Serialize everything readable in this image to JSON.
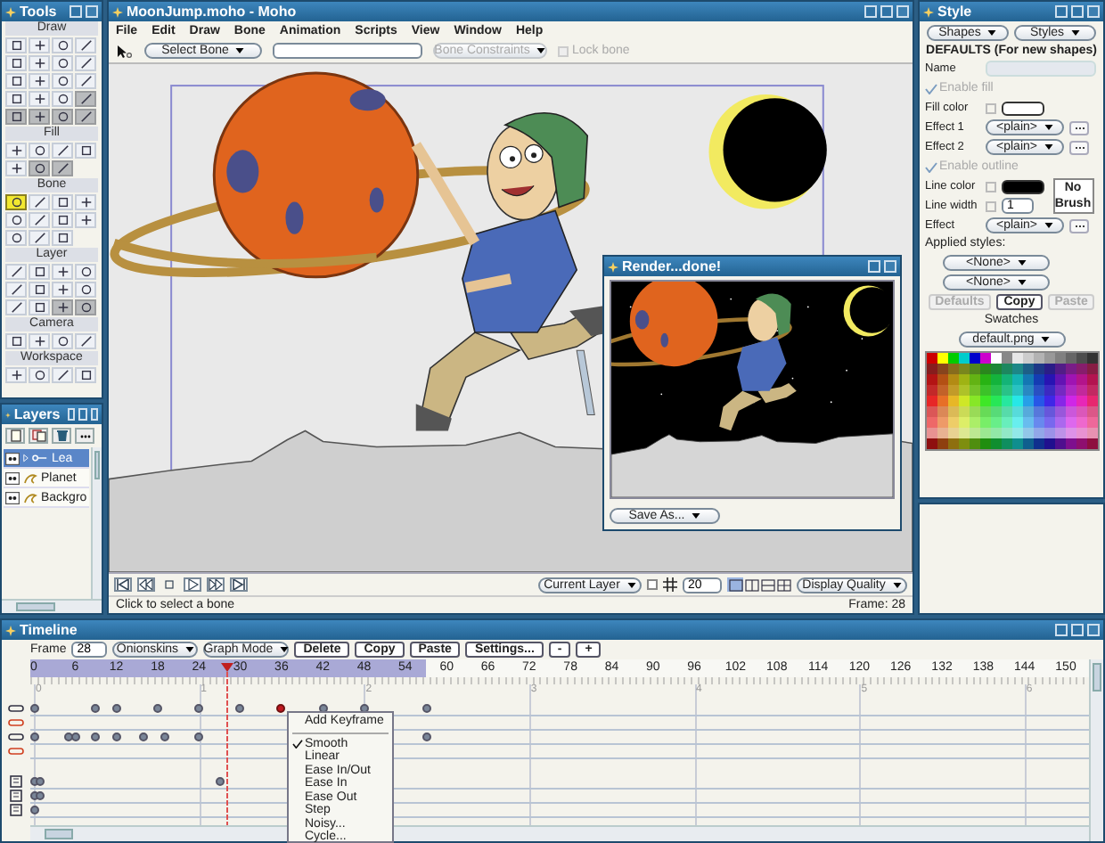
{
  "tools": {
    "title": "Tools",
    "sections": [
      {
        "label": "Draw",
        "tools": [
          {
            "selected": false,
            "disabled": false
          },
          {
            "selected": false,
            "disabled": false
          },
          {
            "selected": false,
            "disabled": false
          },
          {
            "selected": false,
            "disabled": false
          },
          {
            "selected": false,
            "disabled": false
          },
          {
            "selected": false,
            "disabled": false
          },
          {
            "selected": false,
            "disabled": false
          },
          {
            "selected": false,
            "disabled": false
          },
          {
            "selected": false,
            "disabled": false
          },
          {
            "selected": false,
            "disabled": false
          },
          {
            "selected": false,
            "disabled": false
          },
          {
            "selected": false,
            "disabled": false
          },
          {
            "selected": false,
            "disabled": false
          },
          {
            "selected": false,
            "disabled": false
          },
          {
            "selected": false,
            "disabled": false
          },
          {
            "selected": false,
            "disabled": true
          },
          {
            "selected": false,
            "disabled": true
          },
          {
            "selected": false,
            "disabled": true
          },
          {
            "selected": false,
            "disabled": true
          },
          {
            "selected": false,
            "disabled": true
          }
        ]
      },
      {
        "label": "Fill",
        "tools": [
          {
            "selected": false,
            "disabled": false
          },
          {
            "selected": false,
            "disabled": false
          },
          {
            "selected": false,
            "disabled": false
          },
          {
            "selected": false,
            "disabled": false
          },
          {
            "selected": false,
            "disabled": false
          },
          {
            "selected": false,
            "disabled": true
          },
          {
            "selected": false,
            "disabled": true
          }
        ]
      },
      {
        "label": "Bone",
        "tools": [
          {
            "selected": true,
            "disabled": false
          },
          {
            "selected": false,
            "disabled": false
          },
          {
            "selected": false,
            "disabled": false
          },
          {
            "selected": false,
            "disabled": false
          },
          {
            "selected": false,
            "disabled": false
          },
          {
            "selected": false,
            "disabled": false
          },
          {
            "selected": false,
            "disabled": false
          },
          {
            "selected": false,
            "disabled": false
          },
          {
            "selected": false,
            "disabled": false
          },
          {
            "selected": false,
            "disabled": false
          },
          {
            "selected": false,
            "disabled": false
          }
        ]
      },
      {
        "label": "Layer",
        "tools": [
          {
            "selected": false,
            "disabled": false
          },
          {
            "selected": false,
            "disabled": false
          },
          {
            "selected": false,
            "disabled": false
          },
          {
            "selected": false,
            "disabled": false
          },
          {
            "selected": false,
            "disabled": false
          },
          {
            "selected": false,
            "disabled": false
          },
          {
            "selected": false,
            "disabled": false
          },
          {
            "selected": false,
            "disabled": false
          },
          {
            "selected": false,
            "disabled": false
          },
          {
            "selected": false,
            "disabled": false
          },
          {
            "selected": false,
            "disabled": true
          },
          {
            "selected": false,
            "disabled": true
          }
        ]
      },
      {
        "label": "Camera",
        "tools": [
          {
            "selected": false,
            "disabled": false
          },
          {
            "selected": false,
            "disabled": false
          },
          {
            "selected": false,
            "disabled": false
          },
          {
            "selected": false,
            "disabled": false
          }
        ]
      },
      {
        "label": "Workspace",
        "tools": [
          {
            "selected": false,
            "disabled": false
          },
          {
            "selected": false,
            "disabled": false
          },
          {
            "selected": false,
            "disabled": false
          },
          {
            "selected": false,
            "disabled": false
          }
        ]
      }
    ]
  },
  "layers": {
    "title": "Layers",
    "items": [
      {
        "name": "Lea",
        "kind": "bone",
        "selected": true
      },
      {
        "name": "Planet",
        "kind": "vector",
        "selected": false
      },
      {
        "name": "Backgro",
        "kind": "vector",
        "selected": false
      }
    ]
  },
  "main": {
    "title": "MoonJump.moho - Moho",
    "menu": [
      "File",
      "Edit",
      "Draw",
      "Bone",
      "Animation",
      "Scripts",
      "View",
      "Window",
      "Help"
    ],
    "toolbar": {
      "mode_dropdown": "Select Bone",
      "constraints_dropdown": {
        "label": "Bone Constraints",
        "disabled": true
      },
      "lock_bone": {
        "label": "Lock bone",
        "checked": false,
        "disabled": true
      }
    },
    "bottom_bar": {
      "layer_dropdown": "Current Layer",
      "grid_checked": false,
      "grid_size": "20",
      "view_modes": [
        {
          "selected": true
        },
        {
          "selected": false
        },
        {
          "selected": false
        },
        {
          "selected": false
        }
      ],
      "quality_dropdown": "Display Quality"
    },
    "status": "Click to select a bone",
    "frame_label": "Frame: 28"
  },
  "render": {
    "title": "Render...done!",
    "save_dropdown": "Save As..."
  },
  "style": {
    "title": "Style",
    "dropdowns": [
      "Shapes",
      "Styles"
    ],
    "heading": "DEFAULTS (For new shapes)",
    "name_label": "Name",
    "enable_fill": {
      "label": "Enable fill",
      "checked": true,
      "disabled": true
    },
    "fill_color": {
      "label": "Fill color",
      "checked": false,
      "color": "#ffffff"
    },
    "fill_effects": [
      {
        "label": "Effect 1",
        "value": "<plain>"
      },
      {
        "label": "Effect 2",
        "value": "<plain>"
      }
    ],
    "enable_outline": {
      "label": "Enable outline",
      "checked": true,
      "disabled": true
    },
    "line_color": {
      "label": "Line color",
      "checked": false,
      "color": "#000000"
    },
    "line_width": {
      "label": "Line width",
      "checked": false,
      "value": "1"
    },
    "brush": "No Brush",
    "outline_effect": {
      "label": "Effect",
      "value": "<plain>"
    },
    "applied_label": "Applied styles:",
    "applied": [
      "<None>",
      "<None>"
    ],
    "buttons": [
      {
        "label": "Defaults",
        "disabled": true
      },
      {
        "label": "Copy",
        "disabled": false
      },
      {
        "label": "Paste",
        "disabled": true
      }
    ],
    "swatches_label": "Swatches",
    "swatches_dropdown": "default.png"
  },
  "timeline": {
    "title": "Timeline",
    "frame_label": "Frame",
    "frame_value": "28",
    "dropdowns": [
      "Onionskins",
      "Graph Mode"
    ],
    "buttons": [
      "Delete",
      "Copy",
      "Paste",
      "Settings...",
      "-",
      "+"
    ],
    "ruler_labels": [
      "0",
      "6",
      "12",
      "18",
      "24",
      "30",
      "36",
      "42",
      "48",
      "54",
      "60",
      "66",
      "72",
      "78",
      "84",
      "90",
      "96",
      "102",
      "108",
      "114",
      "120",
      "126",
      "132",
      "138",
      "144",
      "150"
    ],
    "second_labels": [
      "0",
      "1",
      "2",
      "3",
      "4",
      "5",
      "6"
    ],
    "tracks": [
      {
        "kind": "bone",
        "highlighted": false,
        "keys": [
          {
            "selected": false
          },
          {
            "selected": false
          },
          {
            "selected": false
          },
          {
            "selected": false
          },
          {
            "selected": false
          },
          {
            "selected": false
          },
          {
            "selected": true
          },
          {
            "selected": false
          },
          {
            "selected": false
          },
          {
            "selected": false
          }
        ]
      },
      {
        "kind": "bone",
        "highlighted": true
      },
      {
        "kind": "bone",
        "highlighted": false,
        "keys": [
          {
            "selected": false
          },
          {
            "selected": false
          },
          {
            "selected": false
          },
          {
            "selected": false
          },
          {
            "selected": false
          },
          {
            "selected": false
          },
          {
            "selected": false
          },
          {
            "selected": false
          },
          {
            "selected": false
          }
        ]
      },
      {
        "kind": "bone",
        "highlighted": true
      },
      {
        "kind": "layer",
        "highlighted": false,
        "keys": [
          {
            "selected": false
          },
          {
            "selected": false
          },
          {
            "selected": false
          }
        ]
      },
      {
        "kind": "layer",
        "highlighted": false,
        "keys": [
          {
            "selected": false
          },
          {
            "selected": false
          }
        ]
      },
      {
        "kind": "layer",
        "highlighted": false,
        "keys": [
          {
            "selected": false
          }
        ]
      }
    ],
    "menu_header": "Add Keyframe",
    "interpolations": [
      {
        "label": "Smooth",
        "checked": true
      },
      {
        "label": "Linear",
        "checked": false
      },
      {
        "label": "Ease In/Out",
        "checked": false
      },
      {
        "label": "Ease In",
        "checked": false
      },
      {
        "label": "Ease Out",
        "checked": false
      },
      {
        "label": "Step",
        "checked": false
      },
      {
        "label": "Noisy...",
        "checked": false
      },
      {
        "label": "Cycle...",
        "checked": false
      }
    ]
  }
}
